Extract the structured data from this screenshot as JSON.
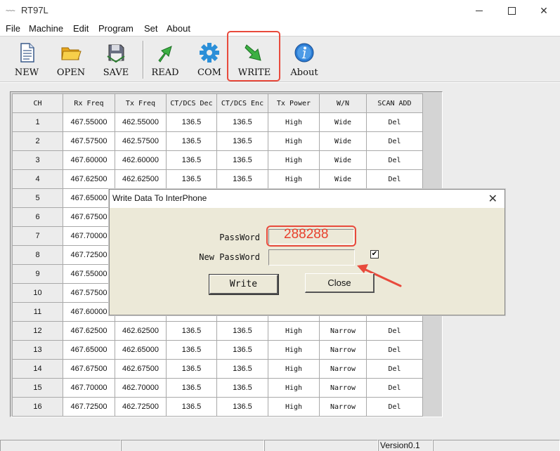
{
  "window": {
    "title": "RT97L",
    "icon_glyph": "~~~"
  },
  "menu": [
    "File",
    "Machine",
    "Edit",
    "Program",
    "Set",
    "About"
  ],
  "toolbar": [
    {
      "id": "new",
      "label": "NEW",
      "icon": "document-icon"
    },
    {
      "id": "open",
      "label": "OPEN",
      "icon": "folder-icon"
    },
    {
      "id": "save",
      "label": "SAVE",
      "icon": "floppy-disk-icon"
    },
    {
      "id": "read",
      "label": "READ",
      "icon": "green-arrow-up-icon"
    },
    {
      "id": "com",
      "label": "COM",
      "icon": "gear-icon"
    },
    {
      "id": "write",
      "label": "WRITE",
      "icon": "green-arrow-down-icon"
    },
    {
      "id": "about",
      "label": "About",
      "icon": "info-icon"
    }
  ],
  "table": {
    "headers": [
      "CH",
      "Rx Freq",
      "Tx Freq",
      "CT/DCS Dec",
      "CT/DCS Enc",
      "Tx Power",
      "W/N",
      "SCAN ADD"
    ],
    "rows": [
      [
        "1",
        "467.55000",
        "462.55000",
        "136.5",
        "136.5",
        "High",
        "Wide",
        "Del"
      ],
      [
        "2",
        "467.57500",
        "462.57500",
        "136.5",
        "136.5",
        "High",
        "Wide",
        "Del"
      ],
      [
        "3",
        "467.60000",
        "462.60000",
        "136.5",
        "136.5",
        "High",
        "Wide",
        "Del"
      ],
      [
        "4",
        "467.62500",
        "462.62500",
        "136.5",
        "136.5",
        "High",
        "Wide",
        "Del"
      ],
      [
        "5",
        "467.65000",
        "",
        "",
        "",
        "",
        "",
        ""
      ],
      [
        "6",
        "467.67500",
        "",
        "",
        "",
        "",
        "",
        ""
      ],
      [
        "7",
        "467.70000",
        "",
        "",
        "",
        "",
        "",
        ""
      ],
      [
        "8",
        "467.72500",
        "",
        "",
        "",
        "",
        "",
        ""
      ],
      [
        "9",
        "467.55000",
        "",
        "",
        "",
        "",
        "",
        ""
      ],
      [
        "10",
        "467.57500",
        "",
        "",
        "",
        "",
        "",
        ""
      ],
      [
        "11",
        "467.60000",
        "",
        "",
        "",
        "",
        "",
        ""
      ],
      [
        "12",
        "467.62500",
        "462.62500",
        "136.5",
        "136.5",
        "High",
        "Narrow",
        "Del"
      ],
      [
        "13",
        "467.65000",
        "462.65000",
        "136.5",
        "136.5",
        "High",
        "Narrow",
        "Del"
      ],
      [
        "14",
        "467.67500",
        "462.67500",
        "136.5",
        "136.5",
        "High",
        "Narrow",
        "Del"
      ],
      [
        "15",
        "467.70000",
        "462.70000",
        "136.5",
        "136.5",
        "High",
        "Narrow",
        "Del"
      ],
      [
        "16",
        "467.72500",
        "462.72500",
        "136.5",
        "136.5",
        "High",
        "Narrow",
        "Del"
      ]
    ]
  },
  "dialog": {
    "title": "Write Data To InterPhone",
    "close_glyph": "✕",
    "password_label": "PassWord",
    "password_value": "288288",
    "new_password_label": "New PassWord",
    "new_password_value": "",
    "checkbox_checked": true,
    "checkbox_glyph": "✔",
    "write_button": "Write",
    "close_button": "Close"
  },
  "status": {
    "version": "Version0.1"
  },
  "colors": {
    "annotation": "#e84a3c"
  }
}
